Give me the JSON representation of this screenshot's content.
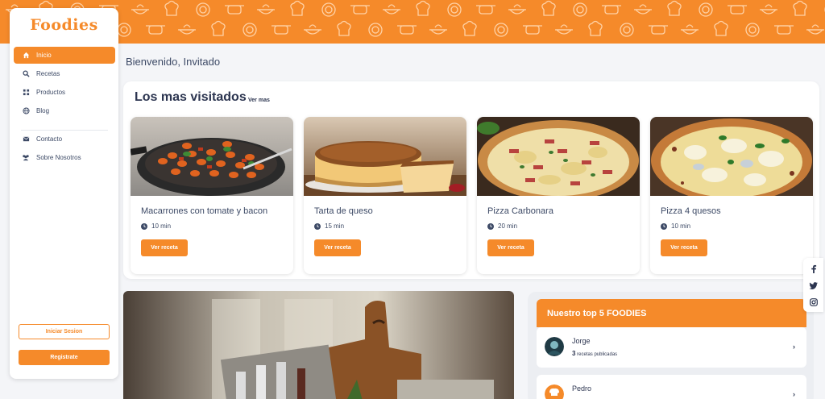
{
  "brand": {
    "name": "Foodies",
    "accent": "#f58a2a",
    "text": "#3d4a66"
  },
  "sidebar": {
    "items": [
      {
        "label": "Inicio",
        "icon": "home-icon",
        "active": true
      },
      {
        "label": "Recetas",
        "icon": "search-icon",
        "active": false
      },
      {
        "label": "Productos",
        "icon": "products-icon",
        "active": false
      },
      {
        "label": "Blog",
        "icon": "globe-icon",
        "active": false
      },
      {
        "label": "Contacto",
        "icon": "envelope-icon",
        "active": false
      },
      {
        "label": "Sobre Nosotros",
        "icon": "users-icon",
        "active": false
      }
    ],
    "login_label": "Iniciar Sesion",
    "register_label": "Registrate"
  },
  "welcome": "Bienvenido, Invitado",
  "most_visited": {
    "title": "Los mas visitados",
    "see_more": "Ver mas",
    "recipes": [
      {
        "name": "Macarrones con tomate y bacon",
        "time": "10 min",
        "button": "Ver receta",
        "image": "pasta-photo"
      },
      {
        "name": "Tarta de queso",
        "time": "15 min",
        "button": "Ver receta",
        "image": "cheesecake-photo"
      },
      {
        "name": "Pizza Carbonara",
        "time": "20 min",
        "button": "Ver receta",
        "image": "pizza-carbonara-photo"
      },
      {
        "name": "Pizza 4 quesos",
        "time": "10 min",
        "button": "Ver receta",
        "image": "pizza-4-quesos-photo"
      }
    ]
  },
  "top_foodies": {
    "title": "Nuestro top 5 FOODIES",
    "users": [
      {
        "name": "Jorge",
        "count": "3",
        "suffix": "recetas publicadas"
      },
      {
        "name": "Pedro",
        "count": "",
        "suffix": ""
      }
    ]
  },
  "social": [
    "facebook-icon",
    "twitter-icon",
    "instagram-icon"
  ]
}
